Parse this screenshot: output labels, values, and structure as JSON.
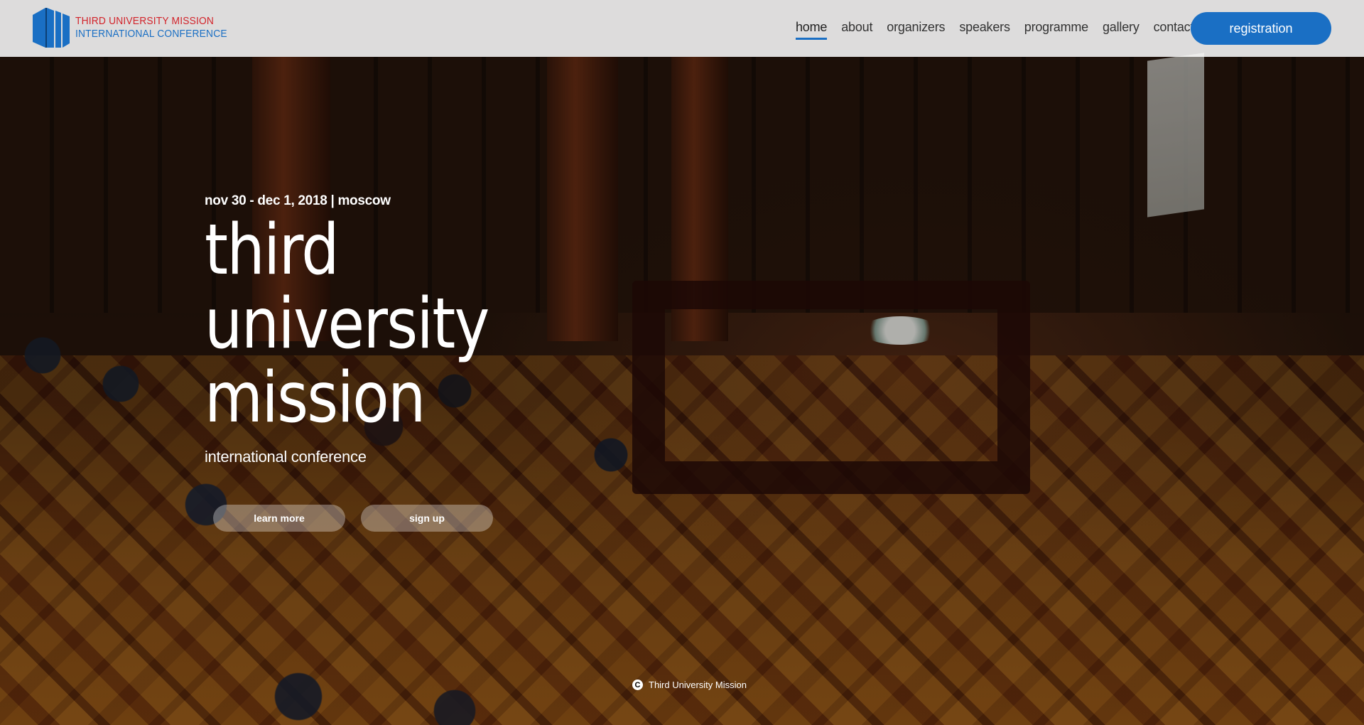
{
  "header": {
    "logo": {
      "line1": "Third University Mission",
      "line2": "International Conference"
    },
    "nav": [
      {
        "label": "home",
        "active": true
      },
      {
        "label": "about",
        "active": false
      },
      {
        "label": "organizers",
        "active": false
      },
      {
        "label": "speakers",
        "active": false
      },
      {
        "label": "programme",
        "active": false
      },
      {
        "label": "gallery",
        "active": false
      },
      {
        "label": "contact",
        "active": false
      }
    ],
    "registration_label": "registration"
  },
  "hero": {
    "date_location": "nov 30 - dec 1, 2018 | moscow",
    "title_lines": [
      "third",
      "university",
      "mission"
    ],
    "subtitle": "international conference",
    "buttons": {
      "learn_more": "learn more",
      "sign_up": "sign up"
    }
  },
  "footer": {
    "copyright_symbol": "C",
    "credit": "Third University Mission"
  },
  "colors": {
    "accent_blue": "#1a6fc4",
    "logo_red": "#d2232a",
    "header_bg": "rgba(255,255,255,0.86)"
  },
  "icons": {
    "logo": "book-columns-logo-icon",
    "copyright": "copyright-icon"
  }
}
